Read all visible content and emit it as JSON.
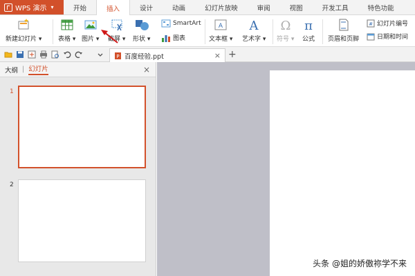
{
  "app": {
    "name": "WPS 演示",
    "brand_color": "#d2502a"
  },
  "menu": {
    "items": [
      {
        "label": "开始",
        "active": false
      },
      {
        "label": "插入",
        "active": true
      },
      {
        "label": "设计",
        "active": false
      },
      {
        "label": "动画",
        "active": false
      },
      {
        "label": "幻灯片放映",
        "active": false
      },
      {
        "label": "审阅",
        "active": false
      },
      {
        "label": "视图",
        "active": false
      },
      {
        "label": "开发工具",
        "active": false
      },
      {
        "label": "特色功能",
        "active": false
      }
    ]
  },
  "ribbon": {
    "new_slide": "新建幻灯片",
    "table": "表格",
    "picture": "图片",
    "screenshot": "截屏",
    "shapes": "形状",
    "smartart": "SmartArt",
    "chart": "图表",
    "textbox": "文本框",
    "wordart": "艺术字",
    "symbol": "符号",
    "formula": "公式",
    "header_footer": "页眉和页脚",
    "slide_number": "幻灯片编号",
    "date_time": "日期和时间"
  },
  "doc_tab": {
    "title": "百度经验.ppt"
  },
  "panel": {
    "tab_outline": "大纲",
    "tab_slides": "幻灯片",
    "slides": [
      {
        "number": "1",
        "selected": true
      },
      {
        "number": "2",
        "selected": false
      }
    ]
  },
  "watermark": "头条 @姐的娇傲祢学不来",
  "icons": [
    "new-slide-icon",
    "table-icon",
    "picture-icon",
    "screenshot-icon",
    "shapes-icon",
    "smartart-icon",
    "chart-icon",
    "textbox-icon",
    "wordart-icon",
    "symbol-icon",
    "formula-icon",
    "header-footer-icon",
    "slide-number-icon",
    "date-time-icon",
    "open-icon",
    "save-icon",
    "print-icon",
    "undo-icon",
    "redo-icon",
    "close-icon",
    "add-tab-icon",
    "red-arrow-icon"
  ]
}
